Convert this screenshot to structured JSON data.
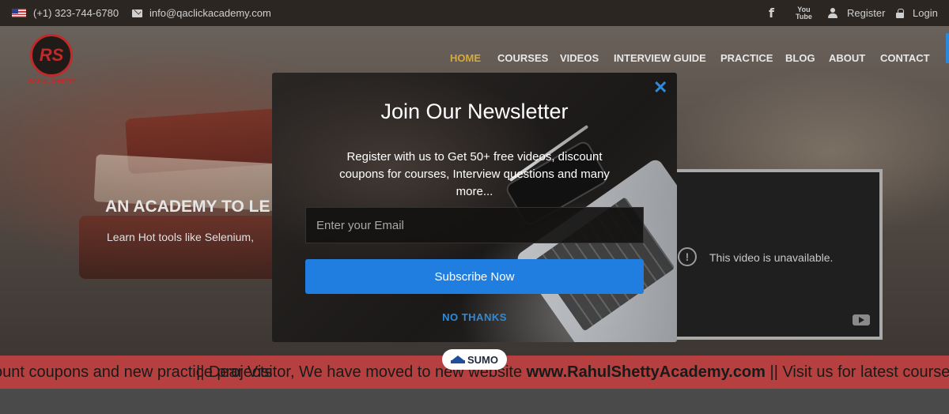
{
  "topbar": {
    "phone": "(+1) 323-744-6780",
    "email": "info@qaclickacademy.com",
    "register": "Register",
    "login": "Login",
    "social": {
      "facebook": "f",
      "youtube": "You\nTube"
    }
  },
  "brand": {
    "monogram": "RS",
    "name": "RAHUL SHETTY"
  },
  "nav": {
    "items": [
      "HOME",
      "COURSES",
      "VIDEOS",
      "INTERVIEW GUIDE",
      "PRACTICE",
      "BLOG",
      "ABOUT",
      "CONTACT"
    ],
    "active": "HOME"
  },
  "hero": {
    "title": "AN ACADEMY TO LE",
    "subtitle": "Learn Hot tools like Selenium,"
  },
  "video": {
    "message": "This video is unavailable."
  },
  "modal": {
    "title": "Join Our Newsletter",
    "description": "Register with us to Get 50+ free videos, discount coupons for courses, Interview questions and many more...",
    "email_placeholder": "Enter your Email",
    "subscribe_label": "Subscribe Now",
    "no_thanks_label": "NO THANKS",
    "close_symbol": "✕"
  },
  "sumo": {
    "label": "SUMO"
  },
  "marquee": {
    "text1": "ount coupons and new practice projects",
    "text2_prefix": "|| Dear Visitor, We have moved to new website ",
    "text2_link": "www.RahulShettyAcademy.com",
    "text2_suffix": " || Visit us for latest courses"
  },
  "colors": {
    "accent": "#1f7ee0",
    "nav_active": "#d4aa3c",
    "marquee_bg": "#b5403f",
    "brand_red": "#c02a2a"
  }
}
